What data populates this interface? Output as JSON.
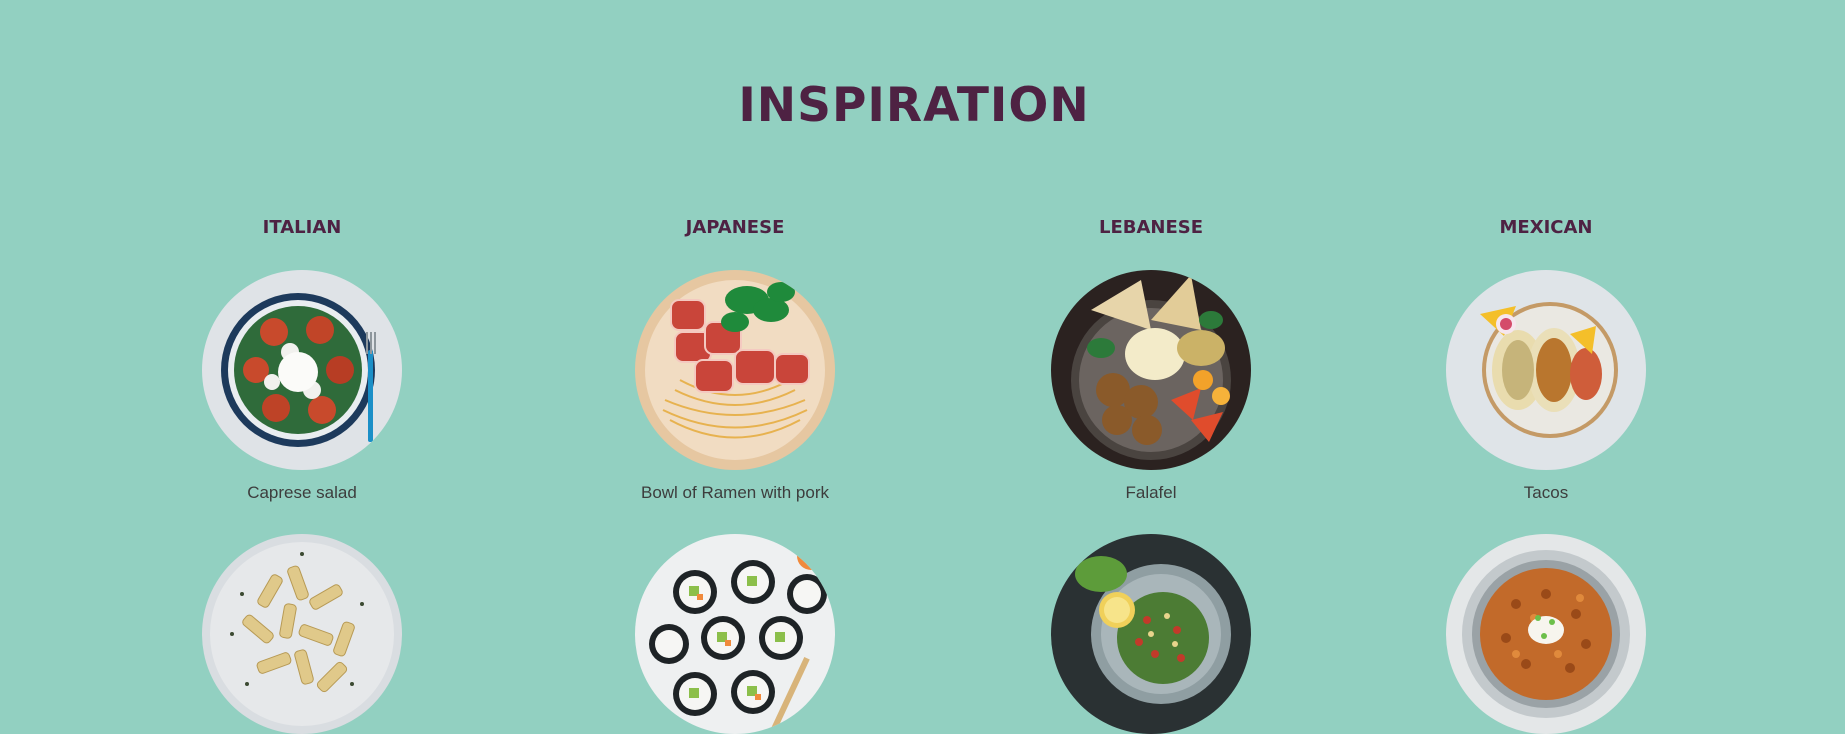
{
  "page": {
    "title": "INSPIRATION",
    "background": "#92d0c1",
    "accent": "#4e2243"
  },
  "cuisines": [
    {
      "heading": "ITALIAN",
      "dishes": [
        {
          "caption": "Caprese salad"
        },
        {
          "caption": ""
        }
      ]
    },
    {
      "heading": "JAPANESE",
      "dishes": [
        {
          "caption": "Bowl of Ramen with pork"
        },
        {
          "caption": ""
        }
      ]
    },
    {
      "heading": "LEBANESE",
      "dishes": [
        {
          "caption": "Falafel"
        },
        {
          "caption": ""
        }
      ]
    },
    {
      "heading": "MEXICAN",
      "dishes": [
        {
          "caption": "Tacos"
        },
        {
          "caption": ""
        }
      ]
    }
  ]
}
